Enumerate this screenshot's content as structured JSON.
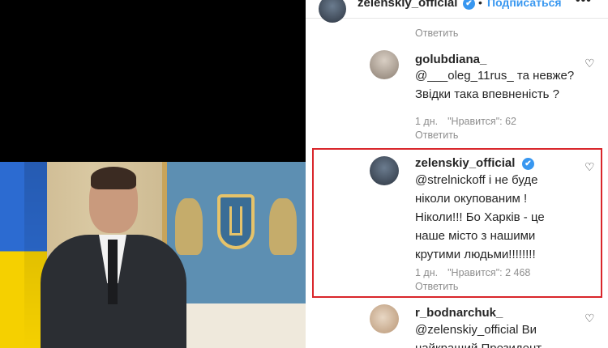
{
  "header": {
    "username": "zelenskiy_official",
    "verified_badge": "✔",
    "separator": "•",
    "follow_label": "Подписаться",
    "more_label": "•••"
  },
  "comments": [
    {
      "reply_label": "Ответить"
    },
    {
      "username": "golubdiana_",
      "lines": [
        "@___oleg_11rus_ та невже?",
        "Звідки така впевненість ?"
      ],
      "time": "1 дн.",
      "likes": "\"Нравится\": 62",
      "reply_label": "Ответить"
    },
    {
      "username": "zelenskiy_official",
      "verified_badge": "✔",
      "lines": [
        "@strelnickoff і не буде",
        "ніколи окупованим !",
        "Ніколи!!! Бо Харків - це",
        "наше місто з нашими",
        "крутими людьми!!!!!!!!"
      ],
      "time": "1 дн.",
      "likes": "\"Нравится\": 2 468",
      "reply_label": "Ответить",
      "highlighted": true,
      "highlight_color": "#d9262b"
    },
    {
      "username": "r_bodnarchuk_",
      "lines": [
        "@zelenskiy_official Ви",
        "найкращий Президент"
      ]
    }
  ],
  "icons": {
    "heart": "♡"
  },
  "colors": {
    "link": "#3897f0",
    "muted": "#8e8e8e",
    "highlight": "#d9262b"
  }
}
